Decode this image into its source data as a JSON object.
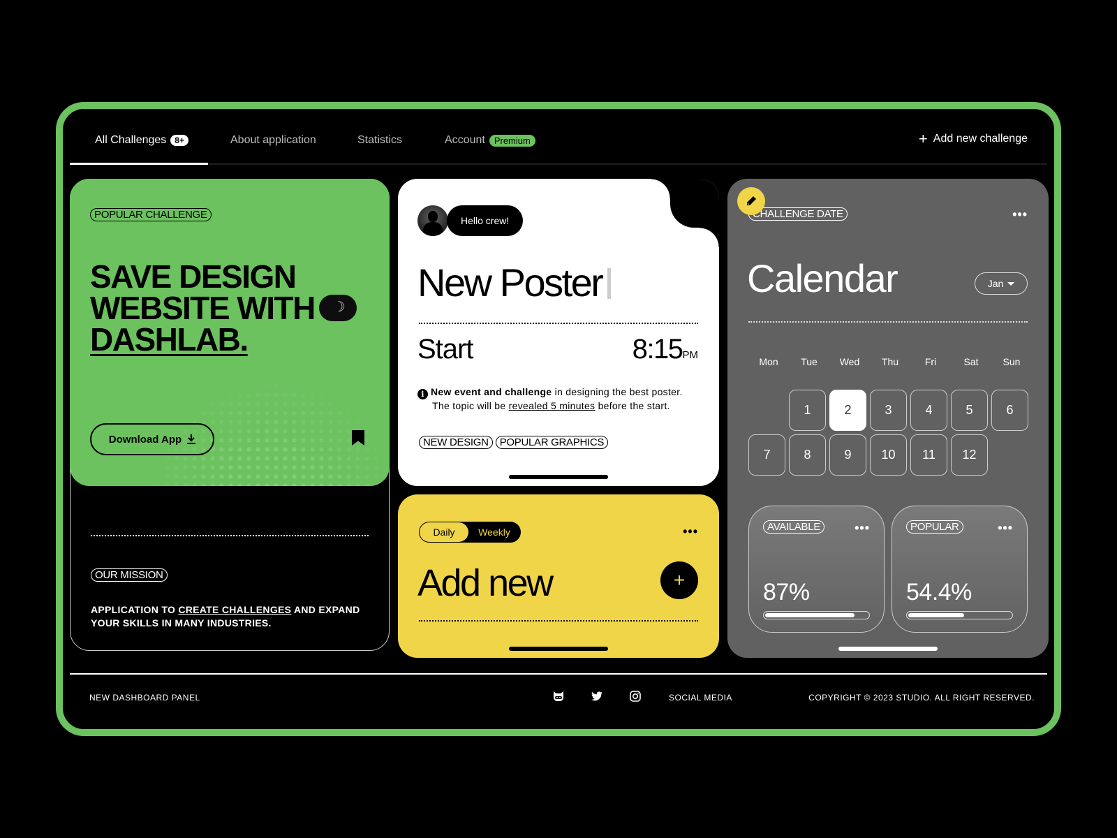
{
  "nav": {
    "tabs": [
      {
        "label": "All Challenges",
        "badge": "8+",
        "active": true
      },
      {
        "label": "About application"
      },
      {
        "label": "Statistics"
      },
      {
        "label": "Account",
        "badge": "Premium"
      }
    ],
    "add_label": "Add new challenge"
  },
  "popular": {
    "tag": "POPULAR CHALLENGE",
    "headline_line1": "SAVE DESIGN",
    "headline_line2": "WEBSITE WITH",
    "headline_line3": "DASHLAB.",
    "download_label": "Download App"
  },
  "mission": {
    "tag": "OUR MISSION",
    "text_before": "APPLICATION TO ",
    "text_link": "CREATE CHALLENGES",
    "text_after": " AND EXPAND YOUR SKILLS IN MANY INDUSTRIES."
  },
  "poster": {
    "greeting": "Hello crew!",
    "title": "New Poster",
    "start_label": "Start",
    "time": "8:15",
    "ampm": "PM",
    "info_bold": "New event and challenge",
    "info_rest": " in designing the best poster.",
    "info_line2_before": "The topic will be ",
    "info_line2_link": "revealed 5 minutes",
    "info_line2_after": " before the start.",
    "tags": [
      "NEW DESIGN",
      "POPULAR GRAPHICS"
    ]
  },
  "addnew": {
    "toggle": [
      "Daily",
      "Weekly"
    ],
    "selected": "Daily",
    "title": "Add new"
  },
  "calendar": {
    "tag": "CHALLENGE DATE",
    "title": "Calendar",
    "month": "Jan",
    "weekdays": [
      "Mon",
      "Tue",
      "Wed",
      "Thu",
      "Fri",
      "Sat",
      "Sun"
    ],
    "days": [
      "1",
      "2",
      "3",
      "4",
      "5",
      "6",
      "7",
      "8",
      "9",
      "10",
      "11",
      "12"
    ],
    "selected_day": "2",
    "stats": [
      {
        "tag": "AVAILABLE",
        "value": "87%",
        "progress": 0.87
      },
      {
        "tag": "POPULAR",
        "value": "54.4%",
        "progress": 0.544
      }
    ]
  },
  "footer": {
    "left": "NEW DASHBOARD PANEL",
    "social_label": "SOCIAL MEDIA",
    "social_icons": [
      "github-icon",
      "twitter-icon",
      "instagram-icon"
    ],
    "copyright": "COPYRIGHT © 2023 STUDIO. ALL RIGHT RESERVED."
  },
  "colors": {
    "accent_green": "#6bc25e",
    "accent_yellow": "#f0d548",
    "card_gray": "#616161"
  }
}
